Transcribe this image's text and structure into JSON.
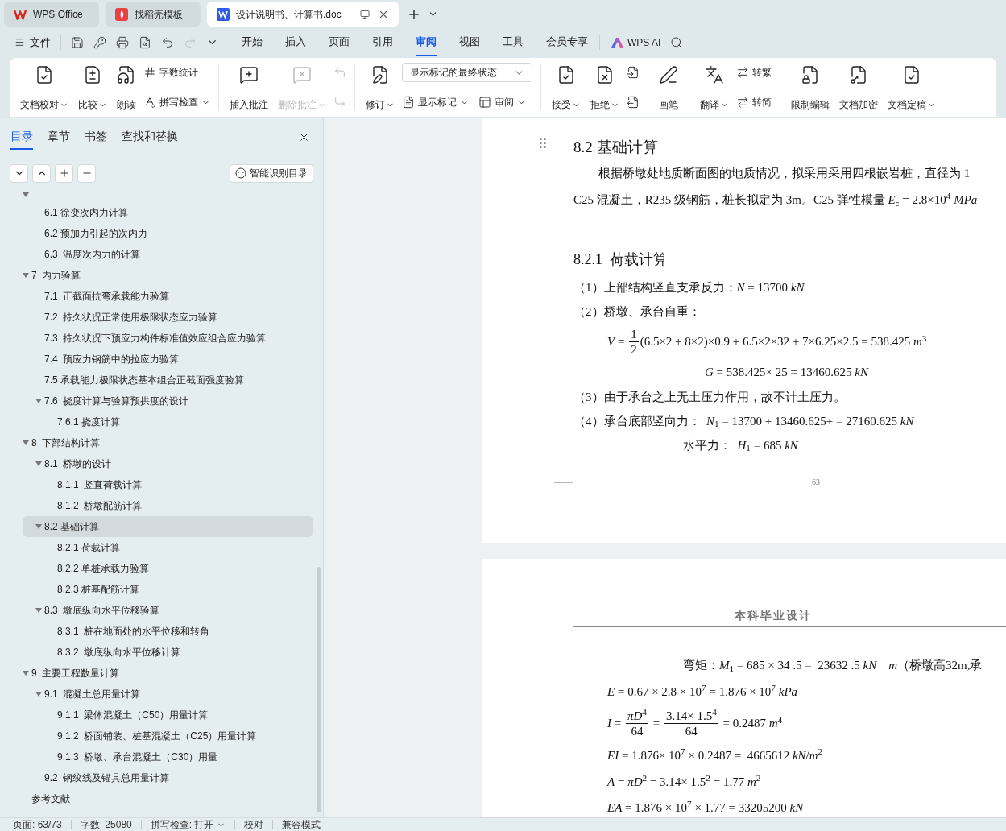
{
  "app_tabs": [
    {
      "title": "WPS Office",
      "selected": false
    },
    {
      "title": "找稻壳模板",
      "selected": false
    },
    {
      "title": "设计说明书、计算书.doc",
      "selected": true
    }
  ],
  "menu": {
    "file": "文件",
    "tabs": [
      {
        "label": "开始",
        "selected": false
      },
      {
        "label": "插入",
        "selected": false
      },
      {
        "label": "页面",
        "selected": false
      },
      {
        "label": "引用",
        "selected": false
      },
      {
        "label": "审阅",
        "selected": true
      },
      {
        "label": "视图",
        "selected": false
      },
      {
        "label": "工具",
        "selected": false
      },
      {
        "label": "会员专享",
        "selected": false
      }
    ],
    "ai": "WPS AI"
  },
  "ribbon": [
    {
      "columns": [
        {
          "kind": "big",
          "label": "文档校对",
          "dropdown": true,
          "disabled": false
        },
        {
          "kind": "big",
          "label": "比较",
          "dropdown": true,
          "disabled": false
        },
        {
          "kind": "big",
          "label": "朗读",
          "dropdown": false,
          "disabled": false
        },
        {
          "kind": "stack",
          "rows": [
            [
              {
                "kind": "small",
                "label": "字数统计",
                "dropdown": false,
                "disabled": false
              }
            ],
            [
              {
                "kind": "small",
                "label": "拼写检查",
                "dropdown": true,
                "disabled": false
              }
            ]
          ]
        }
      ]
    },
    {
      "columns": [
        {
          "kind": "big",
          "label": "插入批注",
          "dropdown": false,
          "disabled": false
        },
        {
          "kind": "big",
          "label": "删除批注",
          "dropdown": true,
          "disabled": true
        },
        {
          "kind": "stack",
          "rows": [
            [
              {
                "kind": "icon",
                "disabled": true
              }
            ],
            [
              {
                "kind": "icon",
                "disabled": true
              }
            ]
          ]
        }
      ]
    },
    {
      "columns": [
        {
          "kind": "big",
          "label": "修订",
          "dropdown": true,
          "disabled": false
        },
        {
          "kind": "stack",
          "rows": [
            [
              {
                "kind": "select",
                "label": "显示标记的最终状态",
                "disabled": false
              }
            ],
            [
              {
                "kind": "small",
                "label": "显示标记",
                "dropdown": true,
                "disabled": false
              },
              {
                "kind": "small",
                "label": "审阅",
                "dropdown": true,
                "disabled": false
              }
            ]
          ]
        }
      ]
    },
    {
      "columns": [
        {
          "kind": "big",
          "label": "接受",
          "dropdown": true,
          "disabled": false
        },
        {
          "kind": "big",
          "label": "拒绝",
          "dropdown": true,
          "disabled": false
        },
        {
          "kind": "stack",
          "rows": [
            [
              {
                "kind": "icon",
                "disabled": false
              }
            ],
            [
              {
                "kind": "icon",
                "disabled": false
              }
            ]
          ]
        }
      ]
    },
    {
      "columns": [
        {
          "kind": "big",
          "label": "画笔",
          "dropdown": false,
          "disabled": false
        }
      ]
    },
    {
      "columns": [
        {
          "kind": "big",
          "label": "翻译",
          "dropdown": true,
          "disabled": false
        },
        {
          "kind": "stack",
          "rows": [
            [
              {
                "kind": "small",
                "label": "转繁",
                "dropdown": false,
                "disabled": false
              }
            ],
            [
              {
                "kind": "small",
                "label": "转简",
                "dropdown": false,
                "disabled": false
              }
            ]
          ]
        }
      ]
    },
    {
      "columns": [
        {
          "kind": "big",
          "label": "限制编辑",
          "dropdown": false,
          "disabled": false
        },
        {
          "kind": "big",
          "label": "文档加密",
          "dropdown": false,
          "disabled": false
        },
        {
          "kind": "big",
          "label": "文档定稿",
          "dropdown": true,
          "disabled": false
        }
      ]
    }
  ],
  "sidebar": {
    "tabs": [
      {
        "label": "目录",
        "selected": true
      },
      {
        "label": "章节",
        "selected": false
      },
      {
        "label": "书签",
        "selected": false
      },
      {
        "label": "查找和替换",
        "selected": false
      }
    ],
    "smart_button": "智能识别目录",
    "tree": [
      {
        "expanded": true,
        "selected": false,
        "children": [
          {
            "label": "6.1 徐变次内力计算",
            "selected": false
          },
          {
            "label": "6.2 预加力引起的次内力",
            "selected": false
          },
          {
            "label": "6.3  温度次内力的计算",
            "selected": false
          }
        ]
      },
      {
        "label": "7  内力验算",
        "expanded": true,
        "selected": false,
        "children": [
          {
            "label": "7.1  正截面抗弯承载能力验算",
            "selected": false
          },
          {
            "label": "7.2  持久状况正常使用极限状态应力验算",
            "selected": false
          },
          {
            "label": "7.3  持久状况下预应力构件标准值效应组合应力验算",
            "selected": false
          },
          {
            "label": "7.4  预应力钢筋中的拉应力验算",
            "selected": false
          },
          {
            "label": "7.5 承载能力极限状态基本组合正截面强度验算",
            "selected": false
          },
          {
            "label": "7.6  挠度计算与验算预拱度的设计",
            "expanded": true,
            "selected": false,
            "children": [
              {
                "label": "7.6.1 挠度计算",
                "selected": false
              }
            ]
          }
        ]
      },
      {
        "label": "8  下部结构计算",
        "expanded": true,
        "selected": false,
        "children": [
          {
            "label": "8.1  桥墩的设计",
            "expanded": true,
            "selected": false,
            "children": [
              {
                "label": "8.1.1  竖直荷载计算",
                "selected": false
              },
              {
                "label": "8.1.2  桥墩配筋计算",
                "selected": false
              }
            ]
          },
          {
            "label": "8.2 基础计算",
            "expanded": true,
            "selected": true,
            "children": [
              {
                "label": "8.2.1 荷载计算",
                "selected": false
              },
              {
                "label": "8.2.2 单桩承载力验算",
                "selected": false
              },
              {
                "label": "8.2.3 桩基配筋计算",
                "selected": false
              }
            ]
          },
          {
            "label": "8.3  墩底纵向水平位移验算",
            "expanded": true,
            "selected": false,
            "children": [
              {
                "label": "8.3.1  桩在地面处的水平位移和转角",
                "selected": false
              },
              {
                "label": "8.3.2  墩底纵向水平位移计算",
                "selected": false
              }
            ]
          }
        ]
      },
      {
        "label": "9  主要工程数量计算",
        "expanded": true,
        "selected": false,
        "children": [
          {
            "label": "9.1  混凝土总用量计算",
            "expanded": true,
            "selected": false,
            "children": [
              {
                "label": "9.1.1  梁体混凝土（C50）用量计算",
                "selected": false
              },
              {
                "label": "9.1.2  桥面铺装、桩基混凝土（C25）用量计算",
                "selected": false
              },
              {
                "label": "9.1.3  桥墩、承台混凝土（C30）用量",
                "selected": false
              }
            ]
          },
          {
            "label": "9.2  钢绞线及锚具总用量计算",
            "selected": false
          }
        ]
      },
      {
        "label": "参考文献",
        "selected": false
      }
    ]
  },
  "pages": [
    {
      "blocks": [
        {
          "kind": "heading",
          "text": "8.2 基础计算"
        },
        {
          "kind": "first_line",
          "text": "根据桥墩处地质断面图的地质情况，拟采用采用四根嵌岩桩，直径为 1"
        },
        {
          "kind": "line",
          "text": "C25 混凝土，R235 级钢筋，桩长拟定为 3m。C25 弹性模量 *E*$_{c}$ = 2.8×10$^{4}$ *MPa*"
        },
        {
          "kind": "subheading",
          "text": "8.2.1  荷载计算"
        },
        {
          "kind": "item",
          "text": "（1）上部结构竖直支承反力：*N* = 13700 *kN*"
        },
        {
          "kind": "item",
          "text": "（2）桥墩、承台自重："
        },
        {
          "kind": "formula",
          "parts": [
            {
              "kind": "text",
              "text": "*V* = "
            },
            {
              "kind": "fraction",
              "num": "1",
              "den": "2"
            },
            {
              "kind": "text",
              "text": "(6.5×2 + 8×2)×0.9 + 6.5×2×32 + 7×6.25×2.5 = 538.425 *m*$^{3}$"
            }
          ]
        },
        {
          "kind": "result",
          "parts": [
            {
              "kind": "text",
              "text": "*G* = 538.425× 25 = 13460.625 *kN*"
            }
          ]
        },
        {
          "kind": "item",
          "text": "（3）由于承台之上无土压力作用，故不计土压力。"
        },
        {
          "kind": "item",
          "text": "（4）承台底部竖向力：  *N*$_{1}$ = 13700 + 13460.625+ = 27160.625 *kN*"
        },
        {
          "kind": "aside",
          "parts": [
            {
              "kind": "text",
              "text": "水平力：  *H*$_{1}$ = 685 *kN*"
            }
          ]
        }
      ],
      "page_number": "63"
    },
    {
      "header": "本科毕业设计",
      "blocks": [
        {
          "kind": "aside",
          "parts": [
            {
              "kind": "text",
              "text": "弯矩：*M*$_{1}$ = 685 × 34 .5 =  23632 .5 *kN*    *m*（桥墩高32m,承"
            }
          ]
        },
        {
          "kind": "formula",
          "parts": [
            {
              "kind": "text",
              "text": "*E* = 0.67 × 2.8 × 10$^{7}$ = 1.876 × 10$^{7}$ *kPa*"
            }
          ]
        },
        {
          "kind": "formula",
          "parts": [
            {
              "kind": "text",
              "text": "*I* = "
            },
            {
              "kind": "fraction",
              "num": "*πD*$^{4}$",
              "den": "64"
            },
            {
              "kind": "text",
              "text": " = "
            },
            {
              "kind": "fraction",
              "num": "3.14× 1.5$^{4}$",
              "den": "64"
            },
            {
              "kind": "text",
              "text": " = 0.2487 *m*$^{4}$"
            }
          ]
        },
        {
          "kind": "formula",
          "parts": [
            {
              "kind": "text",
              "text": "*EI* = 1.876× 10$^{7}$ × 0.2487 =  4665612 *kN*/*m*$^{2}$"
            }
          ]
        },
        {
          "kind": "formula",
          "parts": [
            {
              "kind": "text",
              "text": "*A* = *πD*$^{2}$ = 3.14× 1.5$^{2}$ = 1.77 *m*$^{2}$"
            }
          ]
        },
        {
          "kind": "formula",
          "parts": [
            {
              "kind": "text",
              "text": "*EA* = 1.876 × 10$^{7}$ × 1.77 = 33205200 *kN*"
            }
          ]
        }
      ]
    }
  ],
  "status_bar": [
    {
      "kind": "text",
      "text": "页面: 63/73"
    },
    {
      "kind": "text",
      "text": "字数: 25080"
    },
    {
      "kind": "dropdown",
      "text": "拼写检查: 打开"
    },
    {
      "kind": "text",
      "text": "校对"
    },
    {
      "kind": "text",
      "text": "兼容模式"
    }
  ]
}
